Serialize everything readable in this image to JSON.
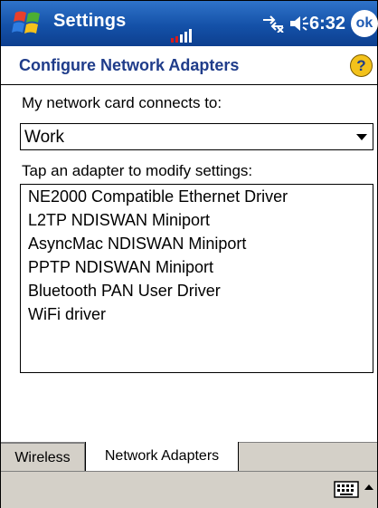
{
  "titlebar": {
    "title": "Settings",
    "time": "6:32",
    "ok_label": "ok"
  },
  "header": {
    "title": "Configure Network Adapters",
    "help_label": "?"
  },
  "connects_label": "My network card connects to:",
  "connects_value": "Work",
  "tap_label": "Tap an adapter to modify settings:",
  "adapters": [
    "NE2000 Compatible Ethernet Driver",
    "L2TP NDISWAN Miniport",
    "AsyncMac NDISWAN Miniport",
    "PPTP NDISWAN Miniport",
    "Bluetooth PAN User Driver",
    "WiFi driver"
  ],
  "tabs": [
    {
      "label": "Wireless"
    },
    {
      "label": "Network Adapters"
    }
  ],
  "colors": {
    "titlebar": "#1451a8",
    "header_text": "#1f3c8a"
  }
}
